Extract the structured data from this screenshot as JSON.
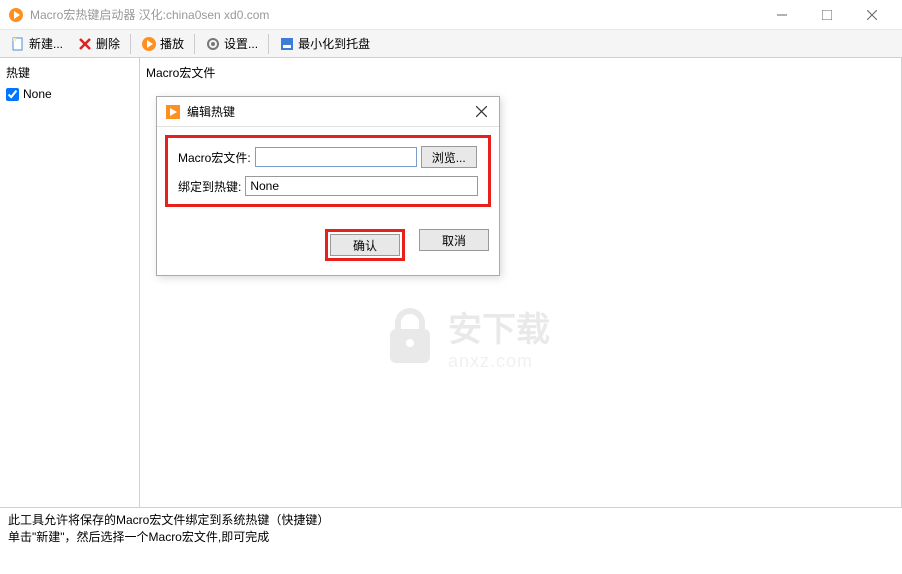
{
  "window": {
    "title": "Macro宏热键启动器 汉化:china0sen xd0.com"
  },
  "toolbar": {
    "new": "新建...",
    "delete": "删除",
    "play": "播放",
    "settings": "设置...",
    "minimize_tray": "最小化到托盘"
  },
  "columns": {
    "hotkey": "热键",
    "macro_file": "Macro宏文件"
  },
  "list": {
    "item0": "None"
  },
  "dialog": {
    "title": "编辑热键",
    "label_file": "Macro宏文件:",
    "file_value": "",
    "browse": "浏览...",
    "label_bind": "绑定到热键:",
    "bind_value": "None",
    "ok": "确认",
    "cancel": "取消"
  },
  "footer": {
    "line1": "此工具允许将保存的Macro宏文件绑定到系统热键（快捷键）",
    "line2": "单击\"新建\"，然后选择一个Macro宏文件,即可完成"
  },
  "watermark": {
    "main": "安下载",
    "sub": "anxz.com"
  }
}
